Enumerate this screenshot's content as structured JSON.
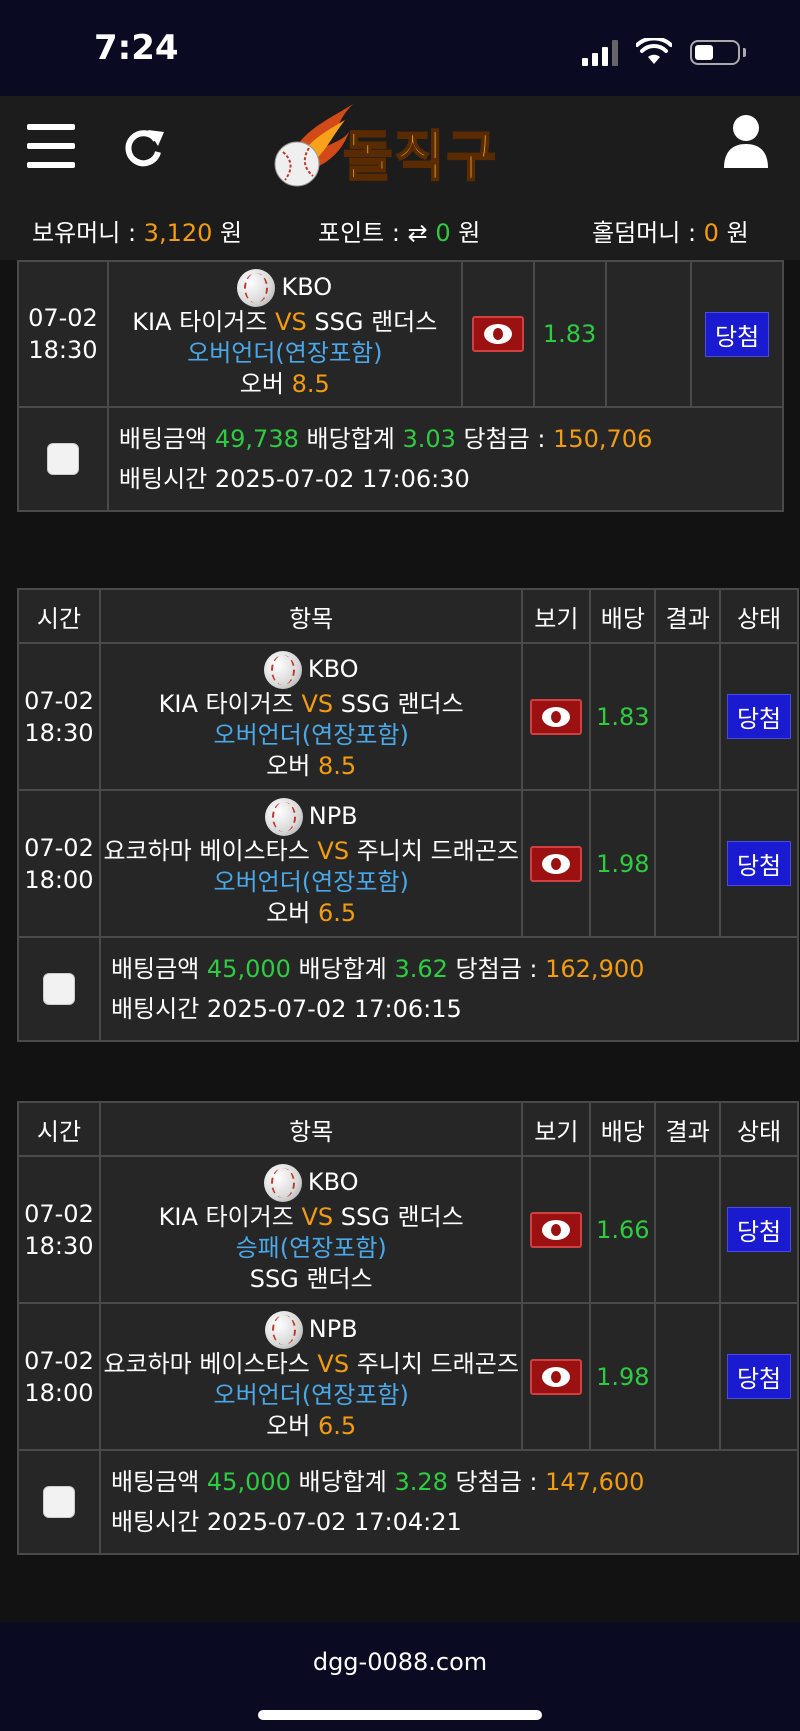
{
  "status": {
    "time": "7:24"
  },
  "header": {
    "logo_text": "돌직구"
  },
  "money": {
    "hold_label": "보유머니 : ",
    "hold_value": "3,120",
    "hold_unit": " 원",
    "point_label": "포인트 : ",
    "point_value": "0",
    "point_unit": " 원",
    "holdem_label": "홀덤머니 : ",
    "holdem_value": "0",
    "holdem_unit": " 원"
  },
  "columns": [
    "시간",
    "항목",
    "보기",
    "배당",
    "결과",
    "상태"
  ],
  "labels": {
    "bet_amount": "배팅금액 ",
    "odds_total": " 배당합계 ",
    "win_amount": " 당첨금 : ",
    "bet_time": "배팅시간 ",
    "vs": " VS ",
    "win_status": "당첨"
  },
  "slips": [
    {
      "rows": [
        {
          "date": "07-02",
          "time": "18:30",
          "league": "KBO",
          "home": "KIA 타이거즈",
          "away": "SSG 랜더스",
          "market": "오버언더(연장포함)",
          "pick": "오버",
          "pick_value": "8.5",
          "odds": "1.83"
        }
      ],
      "amount": "49,738",
      "total_odds": "3.03",
      "payout": "150,706",
      "bet_time": "2025-07-02 17:06:30"
    },
    {
      "rows": [
        {
          "date": "07-02",
          "time": "18:30",
          "league": "KBO",
          "home": "KIA 타이거즈",
          "away": "SSG 랜더스",
          "market": "오버언더(연장포함)",
          "pick": "오버",
          "pick_value": "8.5",
          "odds": "1.83"
        },
        {
          "date": "07-02",
          "time": "18:00",
          "league": "NPB",
          "home": "요코하마 베이스타스",
          "away": "주니치 드래곤즈",
          "market": "오버언더(연장포함)",
          "pick": "오버",
          "pick_value": "6.5",
          "odds": "1.98"
        }
      ],
      "amount": "45,000",
      "total_odds": "3.62",
      "payout": "162,900",
      "bet_time": "2025-07-02 17:06:15"
    },
    {
      "rows": [
        {
          "date": "07-02",
          "time": "18:30",
          "league": "KBO",
          "home": "KIA 타이거즈",
          "away": "SSG 랜더스",
          "market": "승패(연장포함)",
          "pick": "SSG 랜더스",
          "pick_value": "",
          "odds": "1.66"
        },
        {
          "date": "07-02",
          "time": "18:00",
          "league": "NPB",
          "home": "요코하마 베이스타스",
          "away": "주니치 드래곤즈",
          "market": "오버언더(연장포함)",
          "pick": "오버",
          "pick_value": "6.5",
          "odds": "1.98"
        }
      ],
      "amount": "45,000",
      "total_odds": "3.28",
      "payout": "147,600",
      "bet_time": "2025-07-02 17:04:21"
    }
  ],
  "footer": {
    "url": "dgg-0088.com"
  }
}
